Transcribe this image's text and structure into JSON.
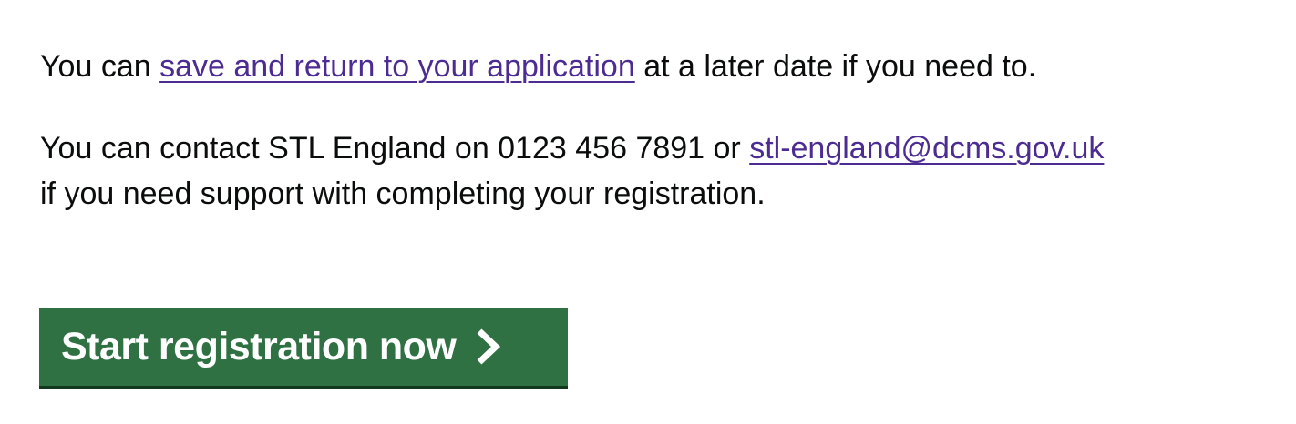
{
  "paragraphs": {
    "save": {
      "prefix": "You can ",
      "link_text": "save and return to your application",
      "suffix": " at a later date if you need to."
    },
    "contact": {
      "prefix": "You can contact STL England on 0123 456 7891 or ",
      "email_link": "stl-england@dcms.gov.uk",
      "suffix": "if you need support with completing your registration."
    }
  },
  "start_button": {
    "label": "Start registration now",
    "icon": "chevron-right-icon"
  },
  "colors": {
    "link": "#4c2c92",
    "button_bg": "#2f7142",
    "button_shadow": "#113a1c",
    "text": "#0b0c0c"
  }
}
